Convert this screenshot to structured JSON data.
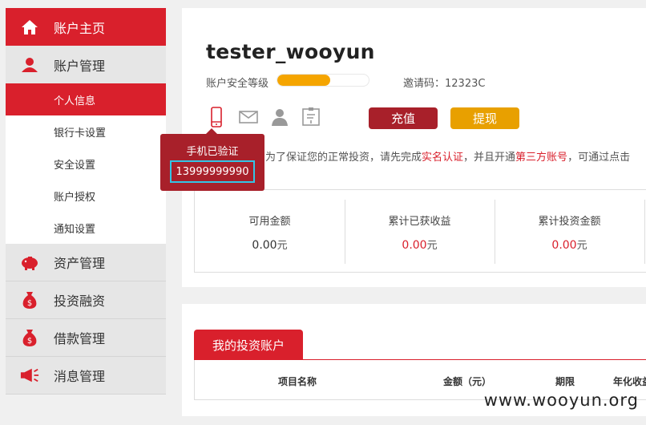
{
  "sidebar": {
    "items": [
      {
        "label": "账户主页",
        "icon": "home-icon"
      },
      {
        "label": "账户管理",
        "icon": "user-icon"
      },
      {
        "label": "个人信息"
      },
      {
        "label": "银行卡设置"
      },
      {
        "label": "安全设置"
      },
      {
        "label": "账户授权"
      },
      {
        "label": "通知设置"
      },
      {
        "label": "资产管理",
        "icon": "piggy-bank-icon"
      },
      {
        "label": "投资融资",
        "icon": "money-bag-icon"
      },
      {
        "label": "借款管理",
        "icon": "money-bag-icon"
      },
      {
        "label": "消息管理",
        "icon": "megaphone-icon"
      }
    ]
  },
  "profile": {
    "username": "tester_wooyun",
    "security_label": "账户安全等级",
    "security_level": 0.58,
    "invite_text": "邀请码：12323C"
  },
  "buttons": {
    "recharge": "充值",
    "withdraw": "提现"
  },
  "notice": {
    "part1": "为了保证您的正常投资，请先完成",
    "link1": "实名认证",
    "part2": "，并且开通",
    "link2": "第三方账号",
    "part3": "，可通过点击"
  },
  "tooltip": {
    "title": "手机已验证",
    "phone": "13999999990"
  },
  "stats": [
    {
      "label": "可用金额",
      "value": "0.00",
      "unit": "元"
    },
    {
      "label": "累计已获收益",
      "value": "0.00",
      "unit": "元"
    },
    {
      "label": "累计投资金额",
      "value": "0.00",
      "unit": "元"
    }
  ],
  "invest_tab": {
    "label": "我的投资账户",
    "columns": [
      "项目名称",
      "金额（元）",
      "期限",
      "年化收益"
    ]
  },
  "watermark": "www.wooyun.org",
  "colors": {
    "brand_red": "#d9202c",
    "dark_red": "#a8202a",
    "orange": "#e8a000",
    "highlight": "#33c5e6"
  }
}
